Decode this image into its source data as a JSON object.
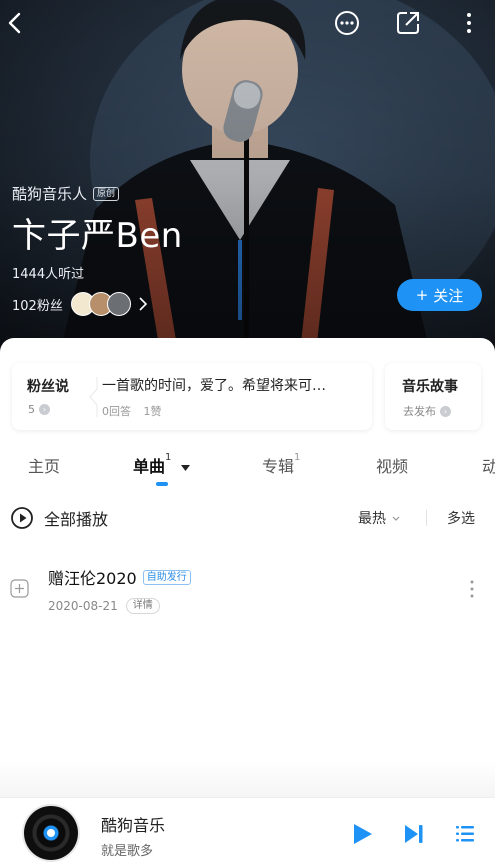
{
  "colors": {
    "accent": "#1f93f5",
    "hero_bg": "#25313f"
  },
  "header": {
    "back_icon": "back-arrow-icon",
    "message_icon": "chat-bubble-icon",
    "share_icon": "share-icon",
    "more_icon": "more-vertical-icon"
  },
  "artist": {
    "label": "酷狗音乐人",
    "original_tag": "原创",
    "name": "卞子严Ben",
    "listens": "1444人听过",
    "fans": "102粉丝",
    "follow_label": "关注"
  },
  "cards": {
    "fans_talk": {
      "title": "粉丝说",
      "count": "5",
      "quote": "一首歌的时间，爱了。希望将来可…",
      "answers": "0回答",
      "likes": "1赞"
    },
    "story": {
      "title": "音乐故事",
      "sub": "去发布"
    }
  },
  "tabs": [
    {
      "label": "主页",
      "count": ""
    },
    {
      "label": "单曲",
      "count": "1"
    },
    {
      "label": "专辑",
      "count": "1"
    },
    {
      "label": "视频",
      "count": ""
    },
    {
      "label": "动",
      "count": ""
    }
  ],
  "list_header": {
    "play_all": "全部播放",
    "sort": "最热",
    "multi": "多选"
  },
  "songs": [
    {
      "title": "赠汪伦2020",
      "tag": "自助发行",
      "date": "2020-08-21",
      "detail": "详情"
    }
  ],
  "player": {
    "title": "酷狗音乐",
    "subtitle": "就是歌多"
  }
}
